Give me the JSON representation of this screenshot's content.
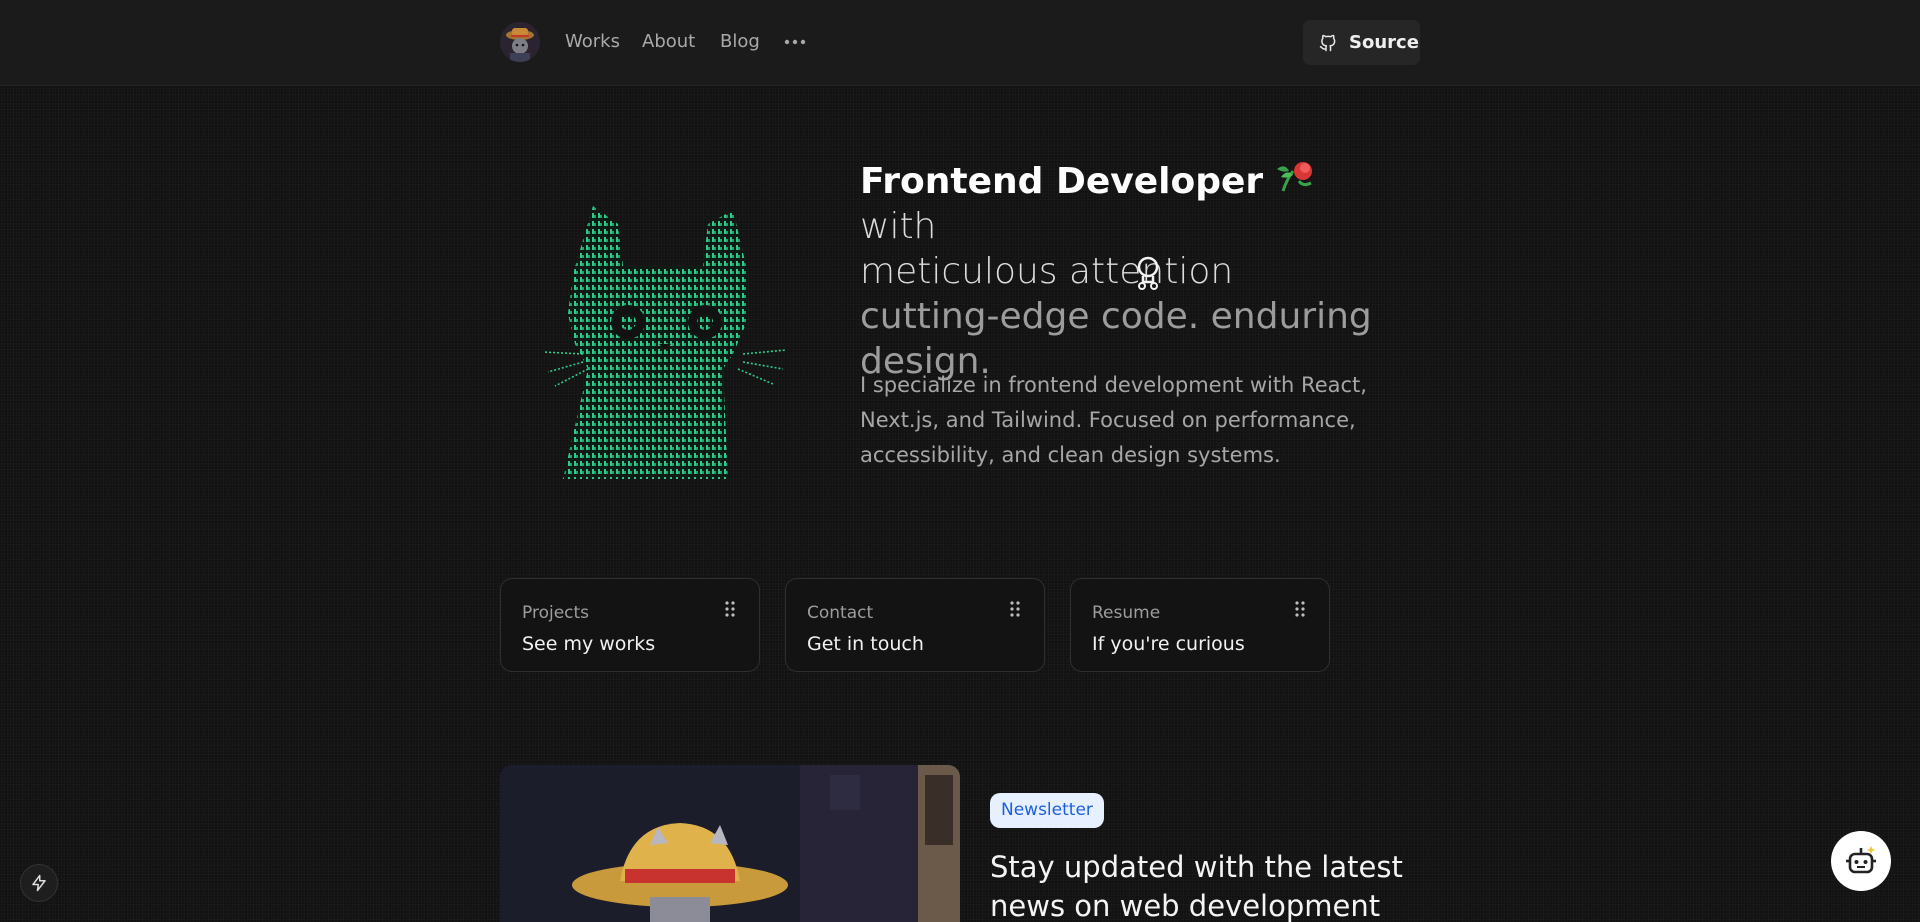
{
  "header": {
    "avatar_icon": "avatar-icon",
    "nav": [
      "Works",
      "About",
      "Blog"
    ],
    "more_icon": "more-horizontal-icon",
    "source_label": "Source",
    "source_icon": "github-icon"
  },
  "hero": {
    "title_strong": "Frontend Developer",
    "title_light_1": "with",
    "title_light_2": "meticulous attention",
    "title_dim": "cutting-edge code. enduring design.",
    "description": "I specialize in frontend development with React, Next.js, and Tailwind. Focused on performance, accessibility, and clean design systems.",
    "art_icon": "ascii-cat-icon",
    "accent_color": "#2ecc8a"
  },
  "cards": [
    {
      "caption": "Projects",
      "title": "See my works"
    },
    {
      "caption": "Contact",
      "title": "Get in touch"
    },
    {
      "caption": "Resume",
      "title": "If you're curious"
    }
  ],
  "newsletter": {
    "badge": "Newsletter",
    "title": "Stay updated with the latest news on web development",
    "badge_color": "#1d5fe0"
  },
  "floating": {
    "left_icon": "bolt-icon",
    "right_icon": "robot-icon"
  }
}
